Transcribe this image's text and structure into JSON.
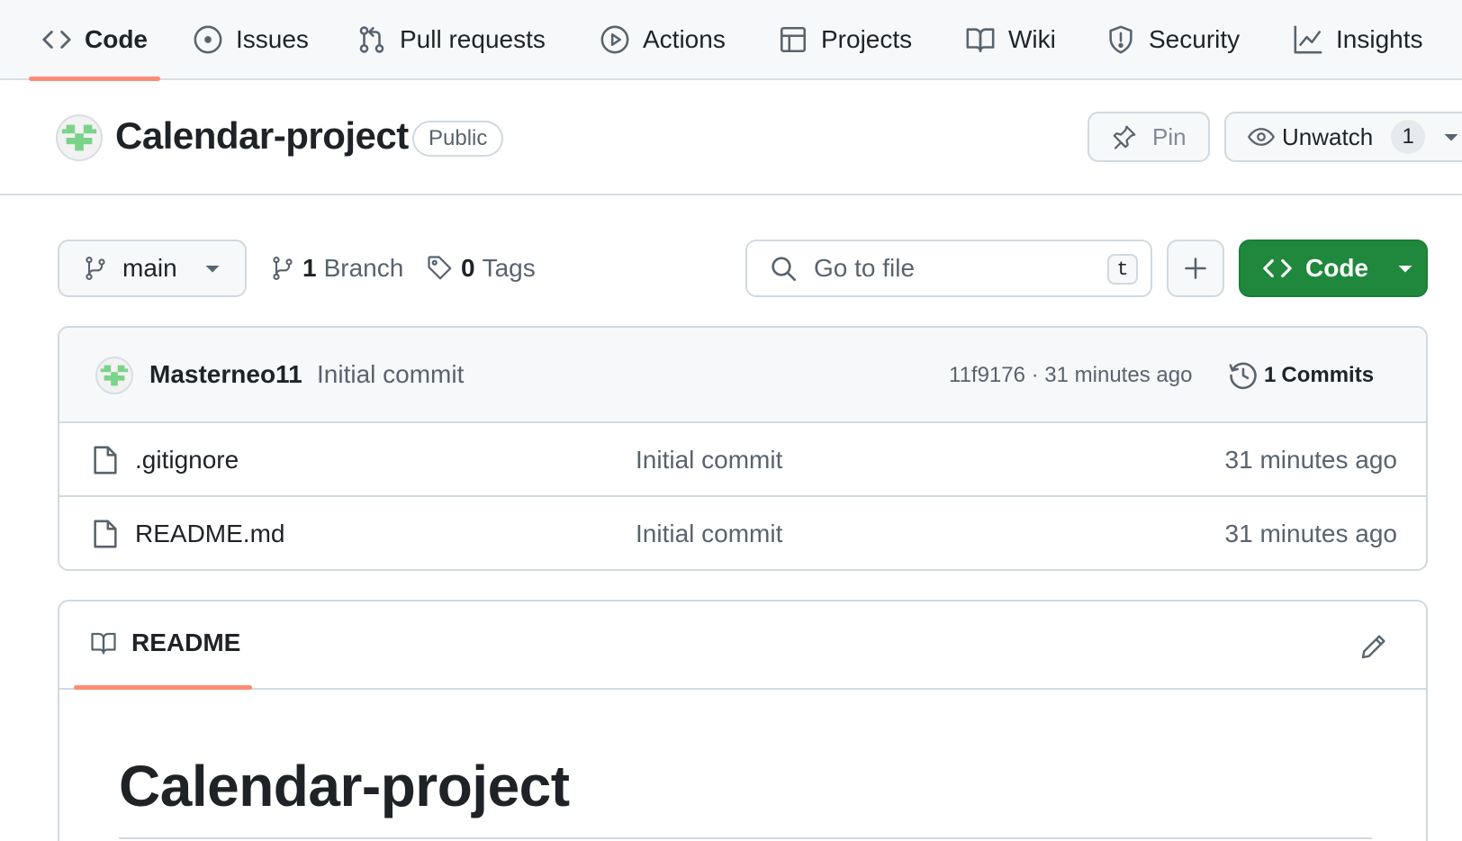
{
  "repo_nav": {
    "tabs": [
      {
        "label": "Code",
        "icon": "code-icon",
        "active": true
      },
      {
        "label": "Issues",
        "icon": "issue-opened-icon"
      },
      {
        "label": "Pull requests",
        "icon": "git-pull-request-icon"
      },
      {
        "label": "Actions",
        "icon": "play-icon"
      },
      {
        "label": "Projects",
        "icon": "table-icon"
      },
      {
        "label": "Wiki",
        "icon": "book-icon"
      },
      {
        "label": "Security",
        "icon": "shield-icon"
      },
      {
        "label": "Insights",
        "icon": "graph-icon"
      }
    ],
    "active_underline_color": "#fd8c73"
  },
  "repo": {
    "name": "Calendar-project",
    "visibility": "Public",
    "pin_label": "Pin",
    "unwatch_label": "Unwatch",
    "watch_count": "1"
  },
  "file_nav": {
    "branch": "main",
    "branch_count": "1",
    "branch_label": "Branch",
    "tag_count": "0",
    "tag_label": "Tags",
    "search_placeholder": "Go to file",
    "search_shortcut": "t",
    "code_button_label": "Code",
    "code_button_color": "#1f883d"
  },
  "latest_commit": {
    "author": "Masterneo11",
    "message": "Initial commit",
    "meta": "11f9176 · 31 minutes ago",
    "commits_count": "1",
    "commits_label": "Commits"
  },
  "files": [
    {
      "name": ".gitignore",
      "commit": "Initial commit",
      "time": "31 minutes ago"
    },
    {
      "name": "README.md",
      "commit": "Initial commit",
      "time": "31 minutes ago"
    }
  ],
  "readme": {
    "tab_label": "README",
    "heading": "Calendar-project"
  }
}
